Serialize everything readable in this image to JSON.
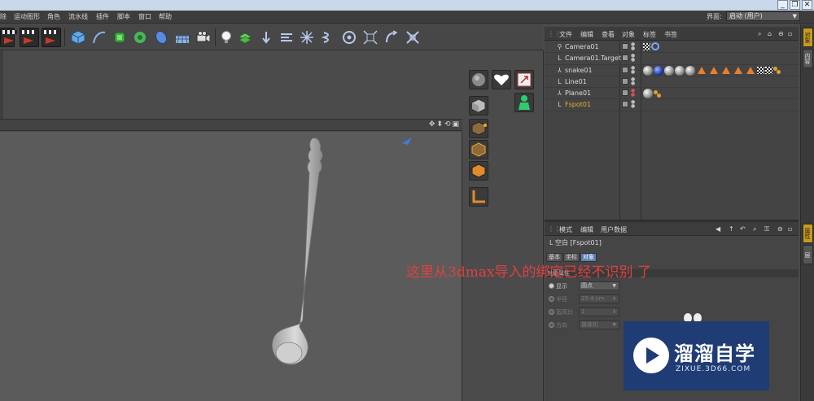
{
  "menubar": {
    "items": [
      "除",
      "运动图形",
      "角色",
      "流水线",
      "插件",
      "脚本",
      "窗口",
      "帮助"
    ],
    "layout_label": "界面:",
    "layout_value": "启动 (用户)"
  },
  "window_controls": [
    "_",
    "❐",
    "✕"
  ],
  "viewport": {
    "nav_icons": [
      "✥",
      "⬍",
      "⟲",
      "▣"
    ]
  },
  "object_manager": {
    "menu": [
      "文件",
      "编辑",
      "查看",
      "对象",
      "标签",
      "书签"
    ],
    "objects": [
      {
        "name": "Camera01",
        "icon": "camera-icon",
        "selected": false
      },
      {
        "name": "Camera01.Target",
        "icon": "null-object-icon",
        "selected": false
      },
      {
        "name": "snake01",
        "icon": "joint-icon",
        "selected": false
      },
      {
        "name": "Line01",
        "icon": "null-object-icon",
        "selected": false
      },
      {
        "name": "Plane01",
        "icon": "joint-icon",
        "selected": false
      },
      {
        "name": "Fspot01",
        "icon": "null-object-icon",
        "selected": true
      }
    ]
  },
  "right_tabs": [
    "对象",
    "内容",
    "属性",
    "层"
  ],
  "attribute_manager": {
    "menu": [
      "模式",
      "编辑",
      "用户数据"
    ],
    "title": "空白 [Fspot01]",
    "tabs": [
      "基本",
      "坐标",
      "对象"
    ],
    "active_tab": "对象",
    "section": "对象属性",
    "fields": [
      {
        "label": "显示",
        "value": "圆点",
        "enabled": true
      },
      {
        "label": "半径",
        "value": "25.4 cm",
        "enabled": false
      },
      {
        "label": "宽高比",
        "value": "1",
        "enabled": false
      },
      {
        "label": "方向",
        "value": "摄像机",
        "enabled": false
      }
    ]
  },
  "annotation": "这里从3dmax导入的绑定已经不识别 了",
  "watermark": {
    "name_cn": "溜溜自学",
    "url": "ZIXUE.3D66.COM"
  },
  "colors": {
    "annotation": "#e04040",
    "selected_object": "#f0a830",
    "active_tab": "#5b7fb3",
    "watermark_bg": "#1f3c74"
  }
}
